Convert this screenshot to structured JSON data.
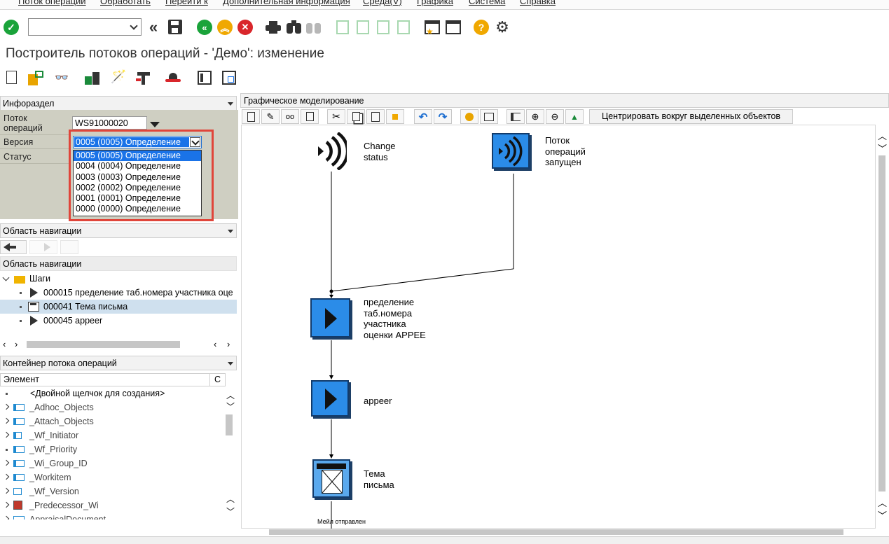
{
  "menu": {
    "items": [
      "Поток операций",
      "Обработать",
      "Перейти к",
      "Дополнительная информация",
      "Среда(V)",
      "Графика",
      "Система",
      "Справка"
    ]
  },
  "toolbar": {
    "command_value": "",
    "icons": [
      "enter-icon",
      "command-field",
      "back-double-icon",
      "save-icon",
      "back-icon",
      "exit-icon",
      "cancel-icon",
      "print-icon",
      "find-icon",
      "find-next-icon",
      "first-page-icon",
      "previous-page-icon",
      "next-page-icon",
      "last-page-icon",
      "create-session-icon",
      "shortcut-icon",
      "help-icon",
      "settings-icon"
    ]
  },
  "page": {
    "title": "Построитель потоков операций - 'Демо': изменение"
  },
  "app_toolbar": {
    "icons": [
      "new-icon",
      "open-icon",
      "display-icon",
      "check-icon",
      "activate-wand-icon",
      "test-icon",
      "hat-icon",
      "list-icon",
      "multi-window-icon"
    ]
  },
  "info_section": {
    "header": "Инфораздел",
    "workflow_label": "Поток операций",
    "workflow_value": "WS91000020",
    "version_label": "Версия",
    "status_label": "Статус",
    "version_selected": "0005 (0005) Определение",
    "version_options": [
      "0005 (0005) Определение",
      "0004 (0004) Определение",
      "0003 (0003) Определение",
      "0002 (0002) Определение",
      "0001 (0001) Определение",
      "0000 (0000) Определение"
    ]
  },
  "nav_area": {
    "header": "Область навигации",
    "tree_header": "Область навигации",
    "root_label": "Шаги",
    "steps": [
      {
        "label": "000015 пределение таб.номера участника оце",
        "selected": false
      },
      {
        "label": "000041 Тема письма",
        "selected": true
      },
      {
        "label": "000045 appeer",
        "selected": false
      }
    ]
  },
  "container": {
    "header": "Контейнер потока операций",
    "col_element": "Элемент",
    "col_c": "С",
    "rows": [
      "<Двойной щелчок для создания>",
      "_Adhoc_Objects",
      "_Attach_Objects",
      "_Wf_Initiator",
      "_Wf_Priority",
      "_Wi_Group_ID",
      "_Workitem",
      "_Wf_Version",
      "_Predecessor_Wi",
      "AppraisalDocument"
    ]
  },
  "graphic": {
    "header": "Графическое моделирование",
    "center_button": "Центрировать вокруг выделенных объектов",
    "nodes": {
      "change_status": "Change\nstatus",
      "wf_started": "Поток\nопераций\nзапущен",
      "step1": "пределение\nтаб.номера\nучастника\nоценки APPEE",
      "step2": "appeer",
      "step3": "Тема\nписьма",
      "mail_sent": "Мейл отправлен"
    }
  },
  "colors": {
    "accent": "#2b8ce8",
    "selection": "#1a73e8",
    "highlight_border": "#e0453a",
    "info_bg": "#cfcfc2"
  }
}
